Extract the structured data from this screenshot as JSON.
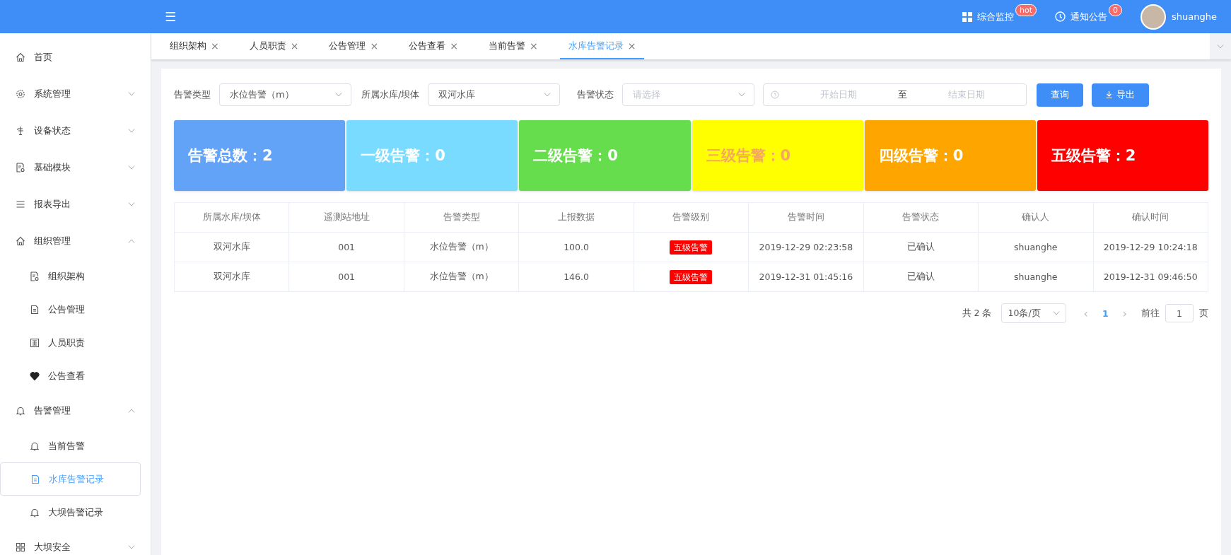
{
  "header": {
    "menu_icon": "☰",
    "links": [
      {
        "label": "综合监控",
        "badge": "hot"
      },
      {
        "label": "通知公告",
        "badge": "0"
      }
    ],
    "user": "shuanghe"
  },
  "sidebar": {
    "items": [
      {
        "label": "首页",
        "selected": false
      },
      {
        "label": "系统管理",
        "expanded": false,
        "selected": false
      },
      {
        "label": "设备状态",
        "expanded": false,
        "selected": false
      },
      {
        "label": "基础模块",
        "expanded": false,
        "selected": false
      },
      {
        "label": "报表导出",
        "expanded": false,
        "selected": false
      },
      {
        "label": "组织管理",
        "expanded": true,
        "selected": false,
        "children": [
          {
            "label": "组织架构",
            "selected": false
          },
          {
            "label": "公告管理",
            "selected": false
          },
          {
            "label": "人员职责",
            "selected": false
          },
          {
            "label": "公告查看",
            "selected": false
          }
        ]
      },
      {
        "label": "告警管理",
        "expanded": true,
        "selected": false,
        "children": [
          {
            "label": "当前告警",
            "selected": false
          },
          {
            "label": "水库告警记录",
            "selected": true
          },
          {
            "label": "大坝告警记录",
            "selected": false
          }
        ]
      },
      {
        "label": "大坝安全",
        "expanded": false,
        "selected": false
      }
    ]
  },
  "tabs": [
    {
      "label": "组织架构",
      "close": "×",
      "selected": false
    },
    {
      "label": "人员职责",
      "close": "×",
      "selected": false
    },
    {
      "label": "公告管理",
      "close": "×",
      "selected": false
    },
    {
      "label": "公告查看",
      "close": "×",
      "selected": false
    },
    {
      "label": "当前告警",
      "close": "×",
      "selected": false
    },
    {
      "label": "水库告警记录",
      "close": "×",
      "selected": true
    }
  ],
  "filters": {
    "alarm_type": {
      "label": "告警类型",
      "value": "水位告警（m）"
    },
    "reservoir": {
      "label": "所属水库/坝体",
      "value": "双河水库"
    },
    "status": {
      "label": "告警状态",
      "placeholder": "请选择"
    },
    "date_range": {
      "start_placeholder": "开始日期",
      "separator": "至",
      "end_placeholder": "结束日期"
    },
    "query_button": "查询",
    "export_button": "导出"
  },
  "stat_cards": [
    {
      "label": "告警总数：2",
      "color": "#62a3f8"
    },
    {
      "label": "一级告警：0",
      "color": "#79dbff"
    },
    {
      "label": "二级告警：0",
      "color": "#66dd4c"
    },
    {
      "label": "三级告警：0",
      "color": "#ffff00"
    },
    {
      "label": "四级告警：0",
      "color": "#ffa500"
    },
    {
      "label": "五级告警：2",
      "color": "#ff0000"
    }
  ],
  "table": {
    "columns": [
      "所属水库/坝体",
      "遥测站地址",
      "告警类型",
      "上报数据",
      "告警级别",
      "告警时间",
      "告警状态",
      "确认人",
      "确认时间"
    ],
    "rows": [
      {
        "reservoir": "双河水库",
        "station": "001",
        "type": "水位告警（m）",
        "data": "100.0",
        "level": "五级告警",
        "time": "2019-12-29 02:23:58",
        "status": "已确认",
        "confirmer": "shuanghe",
        "confirm_time": "2019-12-29 10:24:18"
      },
      {
        "reservoir": "双河水库",
        "station": "001",
        "type": "水位告警（m）",
        "data": "146.0",
        "level": "五级告警",
        "time": "2019-12-31 01:45:16",
        "status": "已确认",
        "confirmer": "shuanghe",
        "confirm_time": "2019-12-31 09:46:50"
      }
    ]
  },
  "pagination": {
    "total": "共 2 条",
    "page_size": "10条/页",
    "prev": "‹",
    "pages": [
      {
        "label": "1",
        "selected": true
      }
    ],
    "next": "›",
    "goto_label": "前往",
    "goto_value": "1",
    "page_suffix": "页"
  }
}
